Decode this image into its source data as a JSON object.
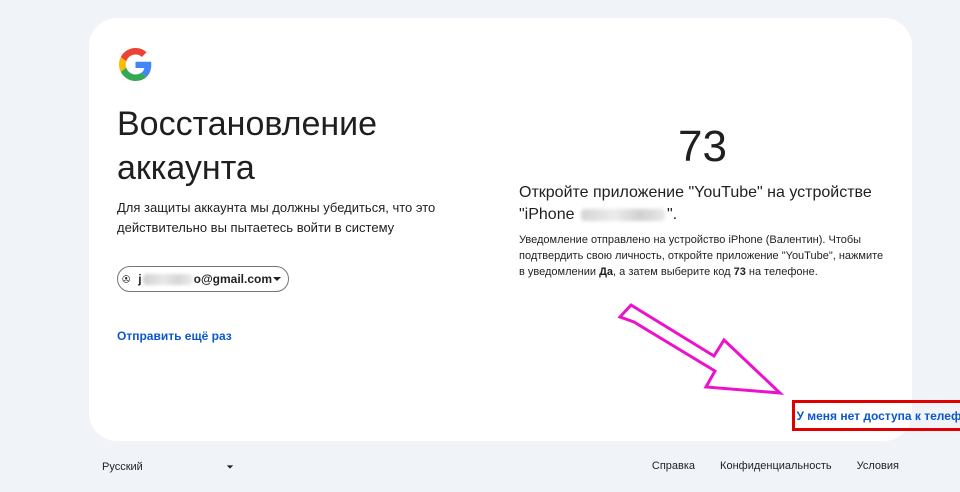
{
  "title": "Восстановление аккаунта",
  "subtitle": "Для защиты аккаунта мы должны убедиться, что это действительно вы пытаетесь войти в систему",
  "account": {
    "email_prefix": "j",
    "email_suffix": "o@gmail.com"
  },
  "resend_label": "Отправить ещё раз",
  "code": "73",
  "open_app": {
    "prefix": "Откройте приложение \"YouTube\" на устройстве \"iPhone",
    "suffix": "\"."
  },
  "notice": {
    "part1": "Уведомление отправлено на устройство iPhone (Валентин). Чтобы подтвердить свою личность, откройте приложение \"YouTube\", нажмите в уведомлении ",
    "yes": "Да",
    "part2": ", а затем выберите код ",
    "code": "73",
    "part3": " на телефоне."
  },
  "no_phone_label": "У меня нет доступа к телефону",
  "footer": {
    "language": "Русский",
    "links": [
      "Справка",
      "Конфиденциальность",
      "Условия"
    ]
  },
  "colors": {
    "background": "#f0f4f9",
    "card": "#ffffff",
    "link": "#0b57d0",
    "highlight_box": "#e00000",
    "arrow": "#ee11cc"
  },
  "icons": {
    "logo": "google-g-logo",
    "avatar": "account-circle-icon",
    "caret": "caret-down-icon"
  }
}
